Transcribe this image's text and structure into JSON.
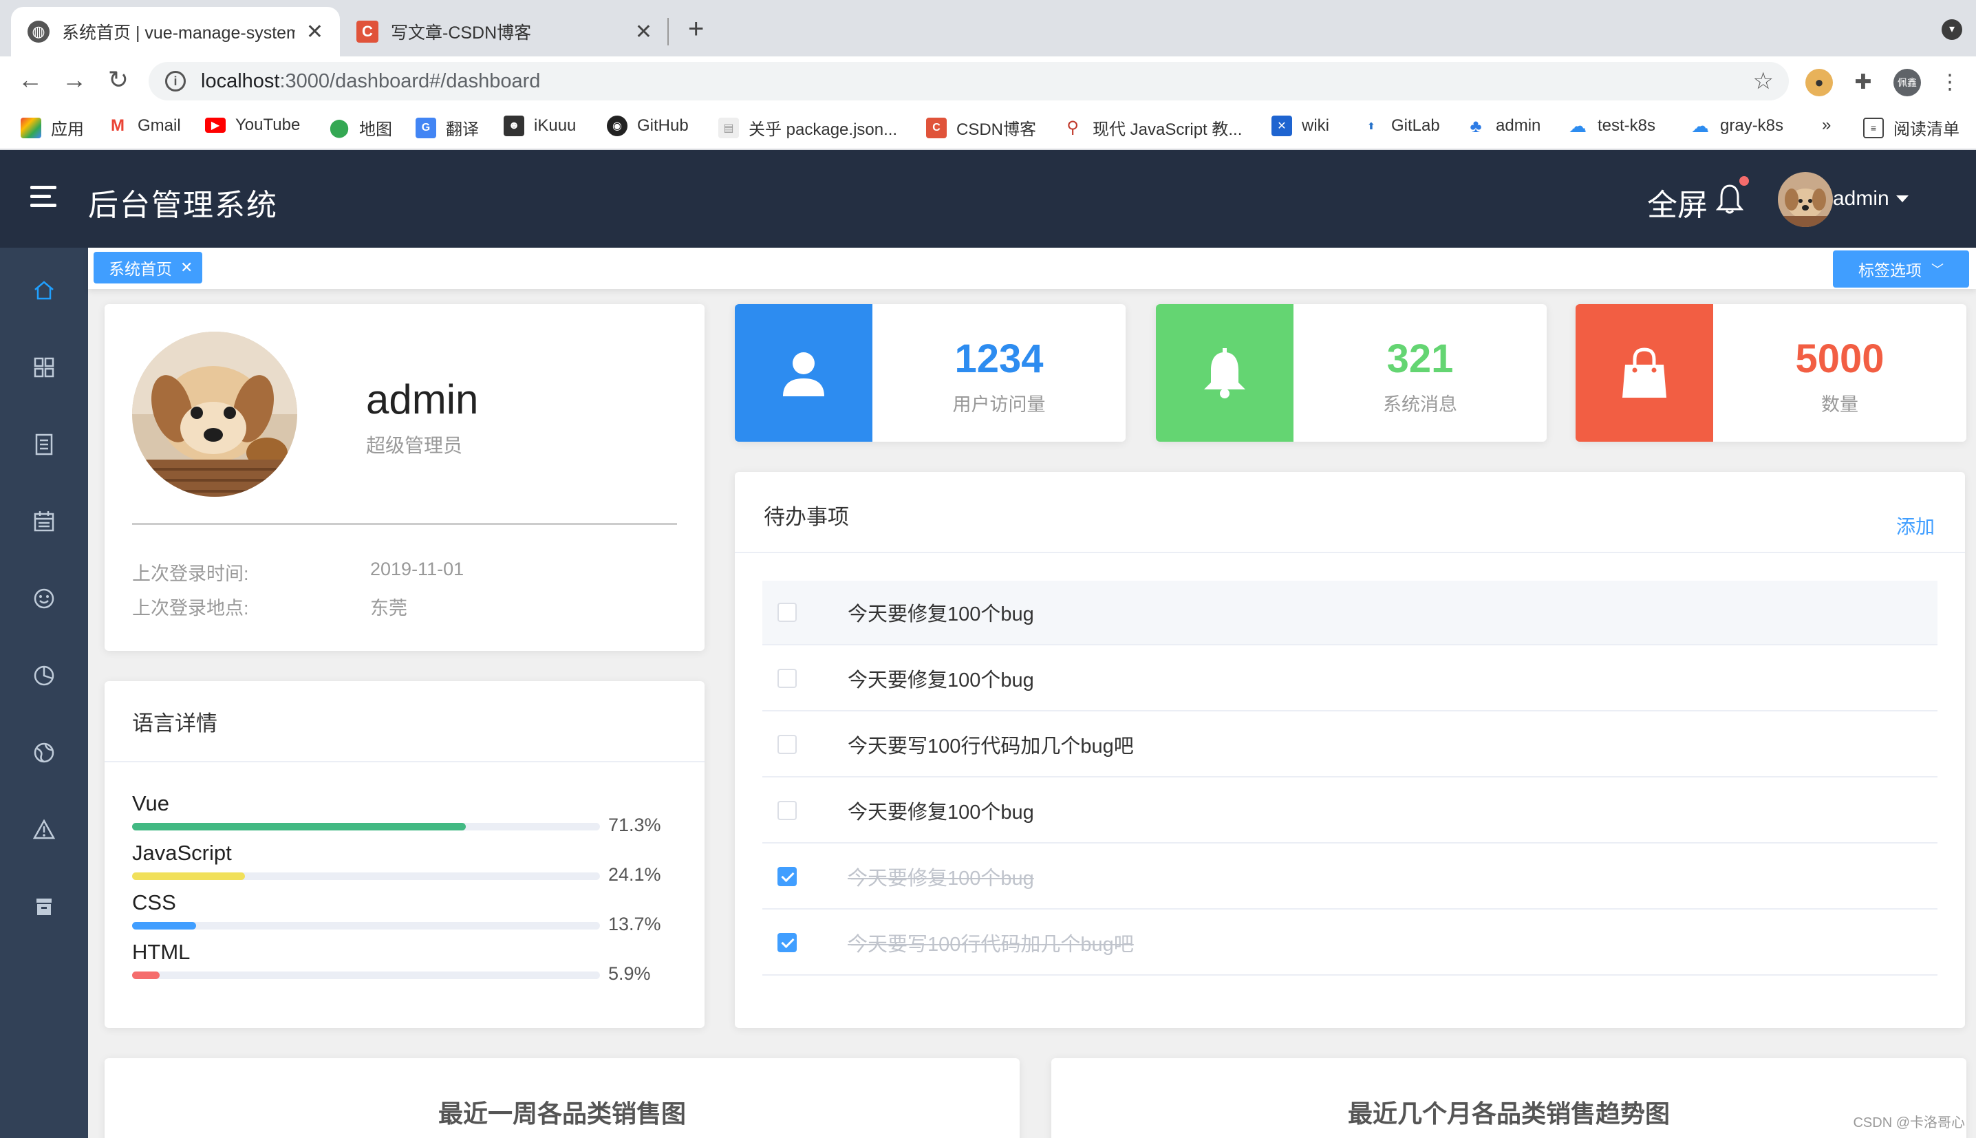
{
  "browser": {
    "tabs": [
      {
        "title": "系统首页 | vue-manage-system",
        "close": "✕"
      },
      {
        "title": "写文章-CSDN博客",
        "close": "✕"
      }
    ],
    "new_tab": "+",
    "url_host": "localhost",
    "url_rest": ":3000/dashboard#/dashboard",
    "profile_initial": "佩鑫",
    "bookmarks": [
      "应用",
      "Gmail",
      "YouTube",
      "地图",
      "翻译",
      "iKuuu",
      "GitHub",
      "关乎 package.json...",
      "CSDN博客",
      "现代 JavaScript 教...",
      "wiki",
      "GitLab",
      "admin",
      "test-k8s",
      "gray-k8s"
    ],
    "bookmarks_more": "»",
    "reading_list": "阅读清单"
  },
  "header": {
    "title": "后台管理系统",
    "fullscreen": "全屏",
    "username": "admin"
  },
  "tags": {
    "active_tag": "系统首页",
    "options_label": "标签选项"
  },
  "profile": {
    "name": "admin",
    "role": "超级管理员",
    "last_login_time_label": "上次登录时间:",
    "last_login_time": "2019-11-01",
    "last_login_place_label": "上次登录地点:",
    "last_login_place": "东莞"
  },
  "languages": {
    "title": "语言详情",
    "items": [
      {
        "name": "Vue",
        "percent_label": "71.3%",
        "percent": 71.3,
        "color": "#42b983"
      },
      {
        "name": "JavaScript",
        "percent_label": "24.1%",
        "percent": 24.1,
        "color": "#f1e05a"
      },
      {
        "name": "CSS",
        "percent_label": "13.7%",
        "percent": 13.7,
        "color": "#409eff"
      },
      {
        "name": "HTML",
        "percent_label": "5.9%",
        "percent": 5.9,
        "color": "#f56c6c"
      }
    ]
  },
  "stats": [
    {
      "value": "1234",
      "label": "用户访问量",
      "color": "#2d8cf0",
      "icon": "user-icon"
    },
    {
      "value": "321",
      "label": "系统消息",
      "color": "#64d572",
      "icon": "bell-icon"
    },
    {
      "value": "5000",
      "label": "数量",
      "color": "#f25e43",
      "icon": "shopping-bag-icon"
    }
  ],
  "todo": {
    "title": "待办事项",
    "add_label": "添加",
    "items": [
      {
        "text": "今天要修复100个bug",
        "done": false
      },
      {
        "text": "今天要修复100个bug",
        "done": false
      },
      {
        "text": "今天要写100行代码加几个bug吧",
        "done": false
      },
      {
        "text": "今天要修复100个bug",
        "done": false
      },
      {
        "text": "今天要修复100个bug",
        "done": true
      },
      {
        "text": "今天要写100行代码加几个bug吧",
        "done": true
      }
    ]
  },
  "charts": {
    "weekly_title": "最近一周各品类销售图",
    "trend_title": "最近几个月各品类销售趋势图"
  },
  "watermark": "CSDN @卡洛哥心"
}
